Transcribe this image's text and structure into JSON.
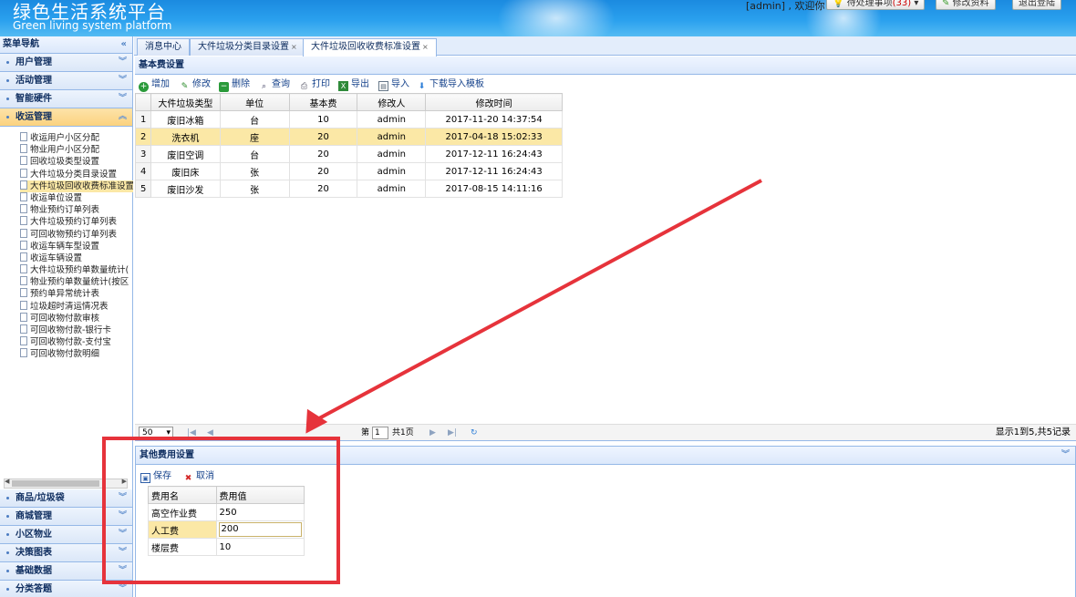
{
  "header": {
    "title_cn": "绿色生活系统平台",
    "title_en": "Green living system platform",
    "user_greeting": "[admin] , 欢迎你！",
    "todo_label": "待处理事项",
    "todo_count": "(33)",
    "profile_label": "修改资料",
    "logout_label": "退出登陆"
  },
  "sidebar": {
    "title": "菜单导航",
    "top_accordions": [
      {
        "label": "用户管理"
      },
      {
        "label": "活动管理"
      },
      {
        "label": "智能硬件"
      },
      {
        "label": "收运管理"
      }
    ],
    "menu_items": [
      "收运用户小区分配",
      "物业用户小区分配",
      "回收垃圾类型设置",
      "大件垃圾分类目录设置",
      "大件垃圾回收收费标准设置",
      "收运单位设置",
      "物业预约订单列表",
      "大件垃圾预约订单列表",
      "可回收物预约订单列表",
      "收运车辆车型设置",
      "收运车辆设置",
      "大件垃圾预约单数量统计(",
      "物业预约单数量统计(按区",
      "预约单异常统计表",
      "垃圾超时清运情况表",
      "可回收物付款审核",
      "可回收物付款-银行卡",
      "可回收物付款-支付宝",
      "可回收物付款明细"
    ],
    "bottom_accordions": [
      {
        "label": "商品/垃圾袋"
      },
      {
        "label": "商城管理"
      },
      {
        "label": "小区物业"
      },
      {
        "label": "决策图表"
      },
      {
        "label": "基础数据"
      },
      {
        "label": "分类答题"
      }
    ]
  },
  "tabs": [
    {
      "label": "消息中心"
    },
    {
      "label": "大件垃圾分类目录设置",
      "close": "×"
    },
    {
      "label": "大件垃圾回收收费标准设置",
      "close": "×"
    }
  ],
  "basic_panel": {
    "title": "基本费设置",
    "toolbar": [
      "增加",
      "修改",
      "删除",
      "查询",
      "打印",
      "导出",
      "导入",
      "下载导入模板"
    ],
    "columns": [
      "大件垃圾类型",
      "单位",
      "基本费",
      "修改人",
      "修改时间"
    ],
    "rows": [
      {
        "n": "1",
        "type": "废旧冰箱",
        "unit": "台",
        "fee": "10",
        "user": "admin",
        "time": "2017-11-20 14:37:54"
      },
      {
        "n": "2",
        "type": "洗衣机",
        "unit": "座",
        "fee": "20",
        "user": "admin",
        "time": "2017-04-18 15:02:33"
      },
      {
        "n": "3",
        "type": "废旧空调",
        "unit": "台",
        "fee": "20",
        "user": "admin",
        "time": "2017-12-11 16:24:43"
      },
      {
        "n": "4",
        "type": "废旧床",
        "unit": "张",
        "fee": "20",
        "user": "admin",
        "time": "2017-12-11 16:24:43"
      },
      {
        "n": "5",
        "type": "废旧沙发",
        "unit": "张",
        "fee": "20",
        "user": "admin",
        "time": "2017-08-15 14:11:16"
      }
    ],
    "pager": {
      "page_size": "50",
      "page_prefix": "第",
      "page_value": "1",
      "page_total": "共1页",
      "summary": "显示1到5,共5记录"
    }
  },
  "other_panel": {
    "title": "其他费用设置",
    "save_label": "保存",
    "cancel_label": "取消",
    "columns": [
      "费用名",
      "费用值"
    ],
    "rows": [
      {
        "name": "高空作业费",
        "value": "250"
      },
      {
        "name": "人工费",
        "value": "200"
      },
      {
        "name": "楼层费",
        "value": "10"
      }
    ]
  },
  "colors": {
    "header_blue": "#2aa0ee",
    "selected_row": "#fbe8a6",
    "annotation_red": "#e6333b",
    "panel_border": "#95b8e7"
  }
}
